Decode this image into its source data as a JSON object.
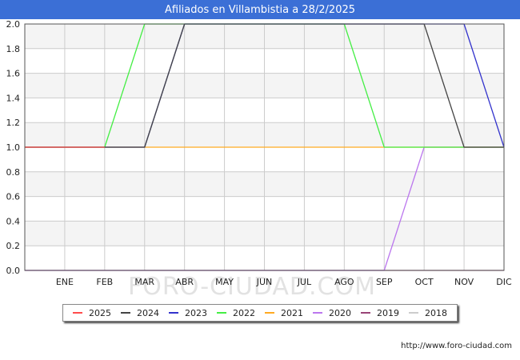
{
  "title": "Afiliados en Villambistia a 28/2/2025",
  "watermark": "FORO-CIUDAD.COM",
  "source_url": "http://www.foro-ciudad.com",
  "colors": {
    "header_bg": "#3b6fd6",
    "band_fill": "#f4f4f4",
    "grid": "#cccccc"
  },
  "chart_data": {
    "type": "line",
    "title": "Afiliados en Villambistia a 28/2/2025",
    "xlabel": "",
    "ylabel": "",
    "x_points": [
      "",
      "ENE",
      "FEB",
      "MAR",
      "ABR",
      "MAY",
      "JUN",
      "JUL",
      "AGO",
      "SEP",
      "OCT",
      "NOV",
      "DIC"
    ],
    "y_ticks": [
      "0.0",
      "0.2",
      "0.4",
      "0.6",
      "0.8",
      "1.0",
      "1.2",
      "1.4",
      "1.6",
      "1.8",
      "2.0"
    ],
    "ylim": [
      0,
      2
    ],
    "grid": true,
    "legend_position": "bottom",
    "series": [
      {
        "name": "2025",
        "color": "#ff4d4d",
        "values": [
          1,
          1,
          1
        ]
      },
      {
        "name": "2024",
        "color": "#444444",
        "values": [
          1,
          1,
          1,
          1,
          2,
          2,
          2,
          2,
          2,
          2,
          2,
          1,
          1
        ]
      },
      {
        "name": "2023",
        "color": "#3333cc",
        "values": [
          1,
          1,
          1,
          1,
          2,
          2,
          2,
          2,
          2,
          2,
          2,
          2,
          1
        ]
      },
      {
        "name": "2022",
        "color": "#44ee44",
        "values": [
          1,
          1,
          1,
          2,
          2,
          2,
          2,
          2,
          2,
          1,
          1,
          1,
          1
        ]
      },
      {
        "name": "2021",
        "color": "#ffaa22",
        "values": [
          1,
          1,
          1,
          1,
          1,
          1,
          1,
          1,
          1,
          1,
          1,
          1,
          1
        ]
      },
      {
        "name": "2020",
        "color": "#bb77ee",
        "values": [
          0,
          0,
          0,
          0,
          0,
          0,
          0,
          0,
          0,
          0,
          1,
          1,
          1
        ]
      },
      {
        "name": "2019",
        "color": "#994477",
        "values": [
          0,
          0,
          0,
          0,
          0,
          0,
          0,
          0,
          0,
          0,
          0,
          0,
          0
        ]
      },
      {
        "name": "2018",
        "color": "#cccccc",
        "values": []
      }
    ]
  }
}
